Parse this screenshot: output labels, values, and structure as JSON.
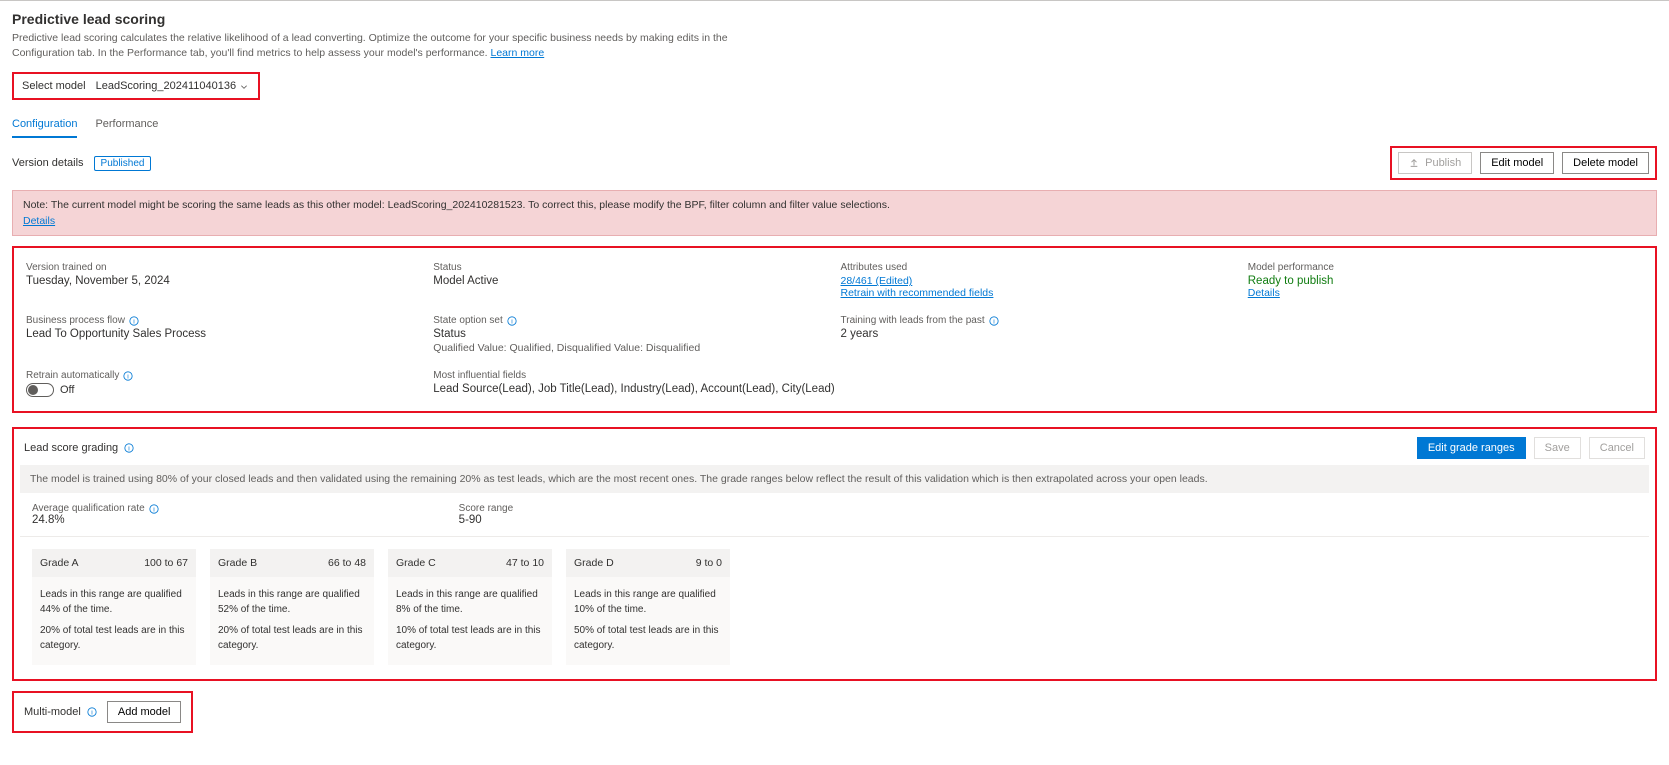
{
  "header": {
    "title": "Predictive lead scoring",
    "subtitle": "Predictive lead scoring calculates the relative likelihood of a lead converting. Optimize the outcome for your specific business needs by making edits in the Configuration tab. In the Performance tab, you'll find metrics to help assess your model's performance.",
    "learn_more": "Learn more"
  },
  "model_picker": {
    "label": "Select model",
    "value": "LeadScoring_202411040136"
  },
  "tabs": {
    "configuration": "Configuration",
    "performance": "Performance"
  },
  "version": {
    "label": "Version details",
    "badge": "Published"
  },
  "actions": {
    "publish": "Publish",
    "edit": "Edit model",
    "delete": "Delete model"
  },
  "banner": {
    "text": "Note: The current model might be scoring the same leads as this other model: LeadScoring_202410281523. To correct this, please modify the BPF, filter column and filter value selections.",
    "details": "Details"
  },
  "details": {
    "trained_on_label": "Version trained on",
    "trained_on_value": "Tuesday, November 5, 2024",
    "status_label": "Status",
    "status_value": "Model Active",
    "attrs_label": "Attributes used",
    "attrs_value": "28/461 (Edited)",
    "attrs_link": "Retrain with recommended fields",
    "perf_label": "Model performance",
    "perf_value": "Ready to publish",
    "perf_link": "Details",
    "bpf_label": "Business process flow",
    "bpf_value": "Lead To Opportunity Sales Process",
    "sos_label": "State option set",
    "sos_value": "Status",
    "sos_sub": "Qualified Value: Qualified, Disqualified Value: Disqualified",
    "train_past_label": "Training with leads from the past",
    "train_past_value": "2 years",
    "retrain_label": "Retrain automatically",
    "retrain_value": "Off",
    "influential_label": "Most influential fields",
    "influential_value": "Lead Source(Lead), Job Title(Lead), Industry(Lead), Account(Lead), City(Lead)"
  },
  "grading": {
    "title": "Lead score grading",
    "edit_btn": "Edit grade ranges",
    "save_btn": "Save",
    "cancel_btn": "Cancel",
    "explain": "The model is trained using 80% of your closed leads and then validated using the remaining 20% as test leads, which are the most recent ones. The grade ranges below reflect the result of this validation which is then extrapolated across your open leads.",
    "avg_label": "Average qualification rate",
    "avg_value": "24.8%",
    "range_label": "Score range",
    "range_value": "5-90",
    "grades": [
      {
        "name": "Grade A",
        "range": "100 to 67",
        "line1": "Leads in this range are qualified 44% of the time.",
        "line2": "20% of total test leads are in this category."
      },
      {
        "name": "Grade B",
        "range": "66 to 48",
        "line1": "Leads in this range are qualified 52% of the time.",
        "line2": "20% of total test leads are in this category."
      },
      {
        "name": "Grade C",
        "range": "47 to 10",
        "line1": "Leads in this range are qualified 8% of the time.",
        "line2": "10% of total test leads are in this category."
      },
      {
        "name": "Grade D",
        "range": "9 to 0",
        "line1": "Leads in this range are qualified 10% of the time.",
        "line2": "50% of total test leads are in this category."
      }
    ]
  },
  "multimodel": {
    "title": "Multi-model",
    "add": "Add model"
  }
}
